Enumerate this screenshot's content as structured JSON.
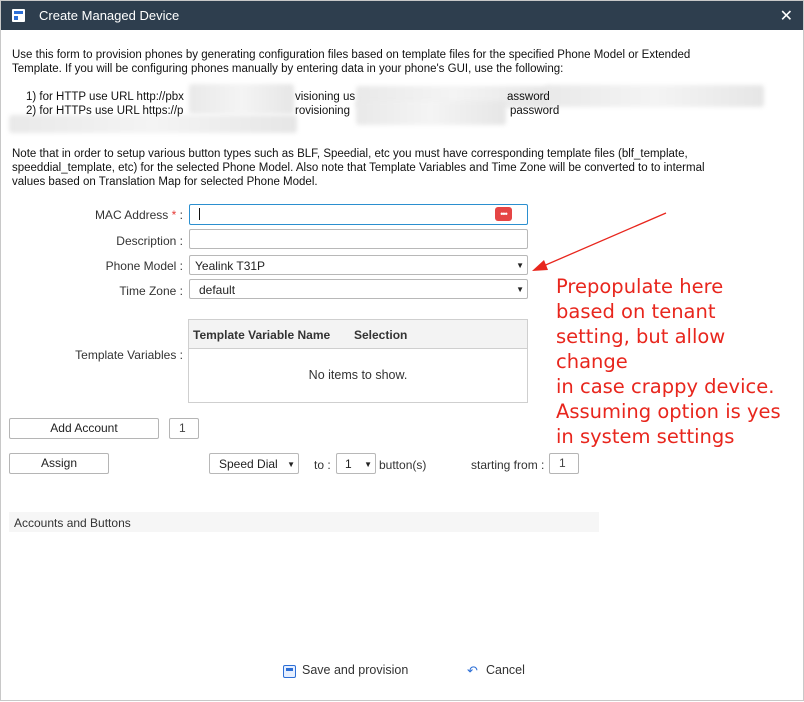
{
  "window": {
    "title": "Create Managed Device"
  },
  "intro": {
    "line1": "Use this form to provision phones by generating configuration files based on template files for the specified Phone Model or Extended",
    "line2": "Template. If you will be configuring phones manually by entering data in your phone's GUI, use the following:",
    "http_a": "1) for HTTP use URL http://pbx",
    "http_b": "visioning us",
    "http_c": "assword",
    "https_a": "2) for HTTPs use URL https://p",
    "https_b": "rovisioning",
    "https_c": "password",
    "note1": "Note that in order to setup various button types such as BLF, Speedial, etc you must have corresponding template files (blf_template,",
    "note2": "speeddial_template, etc) for the selected Phone Model. Also note that Template Variables and Time Zone will be converted to to intermal",
    "note3": "values based on Translation Map for selected Phone Model."
  },
  "form": {
    "mac_label": "MAC Address",
    "required_mark": "*",
    "colon": ":",
    "mac_value": "",
    "description_label": "Description :",
    "description_value": "",
    "phone_model_label": "Phone Model :",
    "phone_model_value": "Yealink T31P",
    "time_zone_label": "Time Zone :",
    "time_zone_value": "default",
    "template_vars_label": "Template Variables :"
  },
  "template_grid": {
    "columns": [
      "Template Variable Name",
      "Selection"
    ],
    "empty_text": "No items to show."
  },
  "accounts": {
    "add_account_label": "Add Account",
    "account_count": "1",
    "assign_label": "Assign",
    "type_value": "Speed Dial",
    "to_label": "to :",
    "to_value": "1",
    "buttons_label": "button(s)",
    "starting_from_label": "starting from :",
    "starting_from_value": "1",
    "section_title": "Accounts and Buttons"
  },
  "footer": {
    "save_label": "Save and provision",
    "cancel_label": "Cancel"
  },
  "annotation": {
    "lines": [
      "Prepopulate here",
      "based on tenant",
      "setting, but allow change",
      "in case crappy device.",
      "Assuming option is yes",
      "in system settings"
    ],
    "color": "#e8261d"
  },
  "colors": {
    "titlebar": "#2e3e4e",
    "accent": "#2d6fd6",
    "focus_border": "#2b8fcf"
  }
}
